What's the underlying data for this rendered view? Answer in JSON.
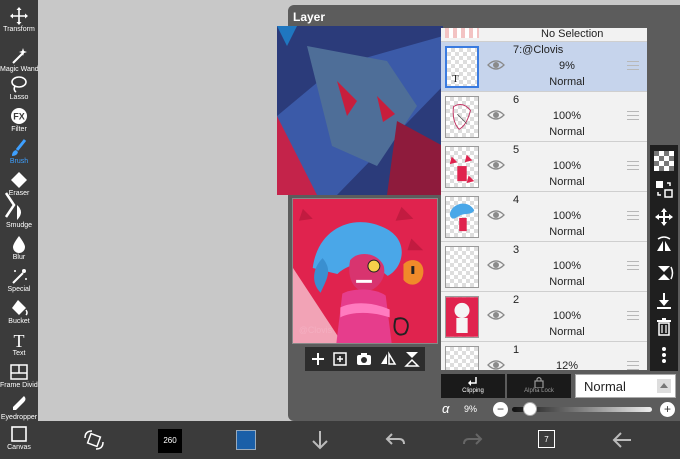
{
  "tools": [
    {
      "label": "Transform",
      "icon": "transform-icon",
      "active": false
    },
    {
      "label": "Magic Wand",
      "icon": "magic-wand-icon",
      "active": false
    },
    {
      "label": "Lasso",
      "icon": "lasso-icon",
      "active": false
    },
    {
      "label": "Filter",
      "icon": "fx-icon",
      "active": false
    },
    {
      "label": "Brush",
      "icon": "brush-icon",
      "active": true
    },
    {
      "label": "Eraser",
      "icon": "eraser-icon",
      "active": false
    },
    {
      "label": "Smudge",
      "icon": "smudge-icon",
      "active": false
    },
    {
      "label": "Blur",
      "icon": "blur-drop-icon",
      "active": false
    },
    {
      "label": "Special",
      "icon": "special-wand-icon",
      "active": false
    },
    {
      "label": "Bucket",
      "icon": "bucket-icon",
      "active": false
    },
    {
      "label": "Text",
      "icon": "text-icon",
      "active": false
    },
    {
      "label": "Frame Divider",
      "icon": "frame-divider-icon",
      "active": false
    },
    {
      "label": "Eyedropper",
      "icon": "eyedropper-icon",
      "active": false
    },
    {
      "label": "Canvas",
      "icon": "canvas-icon",
      "active": false
    }
  ],
  "panel": {
    "title": "Layer",
    "no_selection": "No Selection",
    "layers": [
      {
        "name": "7:@Clovis",
        "opacity": "9%",
        "blend": "Normal",
        "selected": true,
        "thumb": "text-layer"
      },
      {
        "name": "6",
        "opacity": "100%",
        "blend": "Normal",
        "selected": false,
        "thumb": "sketch"
      },
      {
        "name": "5",
        "opacity": "100%",
        "blend": "Normal",
        "selected": false,
        "thumb": "pink-shapes"
      },
      {
        "name": "4",
        "opacity": "100%",
        "blend": "Normal",
        "selected": false,
        "thumb": "blue-hair"
      },
      {
        "name": "3",
        "opacity": "100%",
        "blend": "Normal",
        "selected": false,
        "thumb": "empty"
      },
      {
        "name": "2",
        "opacity": "100%",
        "blend": "Normal",
        "selected": false,
        "thumb": "figure"
      },
      {
        "name": "1",
        "opacity": "12%",
        "blend": "",
        "selected": false,
        "thumb": "empty"
      }
    ],
    "clipping_label": "Clipping",
    "alpha_lock_label": "Alpha Lock",
    "blend_mode": "Normal",
    "alpha_symbol": "α",
    "alpha_value": "9%",
    "alpha_fraction": 0.09,
    "minus": "−",
    "plus": "+"
  },
  "bottom": {
    "brush_size": "260",
    "color": "#1a5fa8",
    "layer_count": "7"
  },
  "preview_watermark": "@Clovis"
}
